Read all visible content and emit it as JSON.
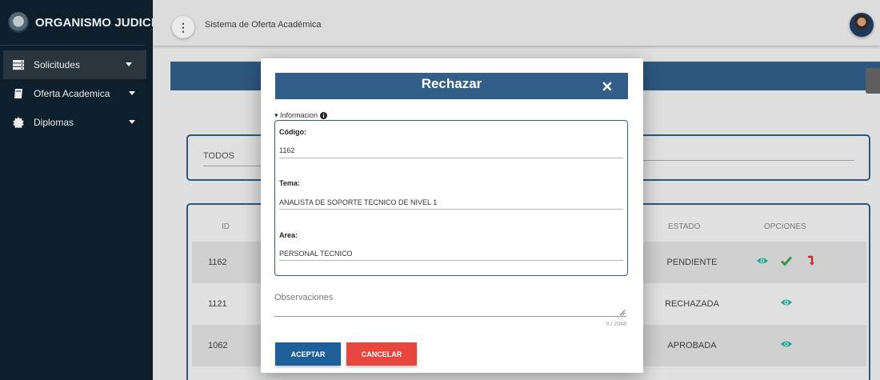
{
  "sidebar": {
    "brand": "ORGANISMO JUDICIAL",
    "items": [
      {
        "label": "Solicitudes",
        "icon": "server-icon"
      },
      {
        "label": "Oferta Academica",
        "icon": "book-icon"
      },
      {
        "label": "Diplomas",
        "icon": "certificate-icon"
      }
    ]
  },
  "topbar": {
    "title": "Sistema de Oferta Académica",
    "menu_glyph": "⋮"
  },
  "filter": {
    "value": "TODOS"
  },
  "table": {
    "headers": {
      "id": "ID",
      "estado": "ESTADO",
      "opciones": "OPCIONES"
    },
    "rows": [
      {
        "id": "1162",
        "estado": "PENDIENTE"
      },
      {
        "id": "1121",
        "estado": "RECHAZADA"
      },
      {
        "id": "1062",
        "estado": "APROBADA"
      }
    ]
  },
  "modal": {
    "title": "Rechazar",
    "section_legend": "▾ Informacion",
    "fields": [
      {
        "label": "Código:",
        "value": "1162"
      },
      {
        "label": "Tema:",
        "value": "ANALISTA DE SOPORTE TECNICO DE NIVEL 1"
      },
      {
        "label": "Area:",
        "value": "PERSONAL TECNICO"
      }
    ],
    "observaciones_label": "Observaciones",
    "counter": "0 / 2048",
    "accept_label": "ACEPTAR",
    "cancel_label": "CANCELAR"
  },
  "colors": {
    "sidebar": "#0f2231",
    "primary": "#315f8a",
    "accept": "#1f5f98",
    "cancel": "#e8463f",
    "view_icon": "#1fb8a6",
    "approve_icon": "#35a84a",
    "reject_icon": "#d9342b"
  }
}
